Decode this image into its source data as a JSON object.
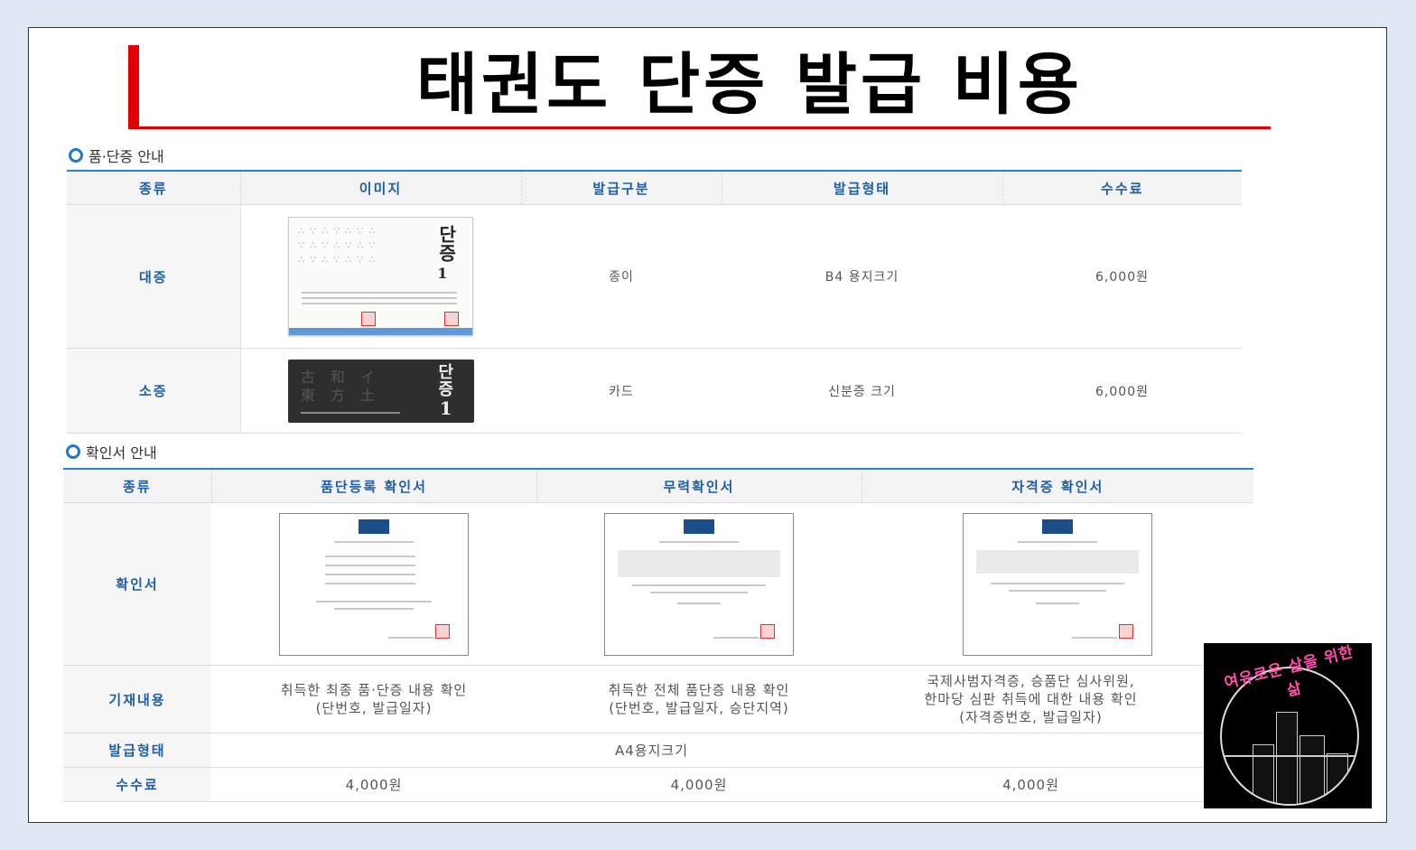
{
  "title": "태권도 단증 발급 비용",
  "section1": {
    "heading": "품·단증 안내",
    "headers": [
      "종류",
      "이미지",
      "발급구분",
      "발급형태",
      "수수료"
    ],
    "rows": [
      {
        "type": "대증",
        "kind": "종이",
        "form": "B4 용지크기",
        "fee": "6,000원"
      },
      {
        "type": "소증",
        "kind": "카드",
        "form": "신분증 크기",
        "fee": "6,000원"
      }
    ],
    "paper_img": {
      "dan_label": "단증",
      "dan_number": "1"
    },
    "card_img": {
      "dan_label": "단증",
      "dan_number": "1"
    }
  },
  "section2": {
    "heading": "확인서 안내",
    "headers": [
      "종류",
      "품단등록 확인서",
      "무력확인서",
      "자격증 확인서"
    ],
    "row_image_label": "확인서",
    "row_content_label": "기재내용",
    "contents": [
      [
        "취득한 최종 품·단증 내용 확인",
        "(단번호, 발급일자)"
      ],
      [
        "취득한 전체 품단증 내용 확인",
        "(단번호, 발급일자, 승단지역)"
      ],
      [
        "국제사범자격증, 승품단 심사위원,",
        "한마당 심판 취득에 대한 내용 확인",
        "(자격증번호, 발급일자)"
      ]
    ],
    "row_form_label": "발급형태",
    "form_value": "A4용지크기",
    "row_fee_label": "수수료",
    "fees": [
      "4,000원",
      "4,000원",
      "4,000원"
    ]
  },
  "badge": {
    "text": "여유로운 삶을 위한 삶"
  }
}
